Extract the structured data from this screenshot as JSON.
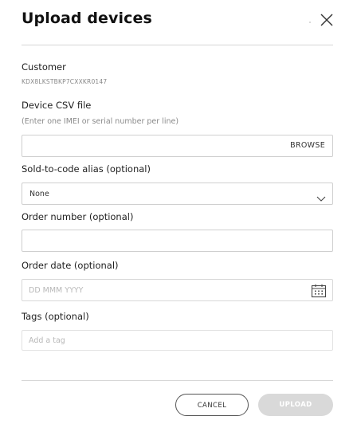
{
  "dialog": {
    "title": "Upload devices",
    "close_icon": "close-icon"
  },
  "customer": {
    "label": "Customer",
    "value": "KDX8LKSTBKP7CXXKR0147"
  },
  "device_csv": {
    "label": "Device CSV file",
    "helper": "(Enter one IMEI or serial number per line)",
    "value": "",
    "browse_label": "BROWSE"
  },
  "sold_to_alias": {
    "label": "Sold-to-code alias (optional)",
    "selected": "None",
    "icon": "chevron-down-icon"
  },
  "order_number": {
    "label": "Order number (optional)",
    "value": ""
  },
  "order_date": {
    "label": "Order date (optional)",
    "placeholder": "DD MMM YYYY",
    "icon": "calendar-icon"
  },
  "tags": {
    "label": "Tags (optional)",
    "placeholder": "Add a tag"
  },
  "footer": {
    "cancel_label": "CANCEL",
    "upload_label": "UPLOAD"
  }
}
